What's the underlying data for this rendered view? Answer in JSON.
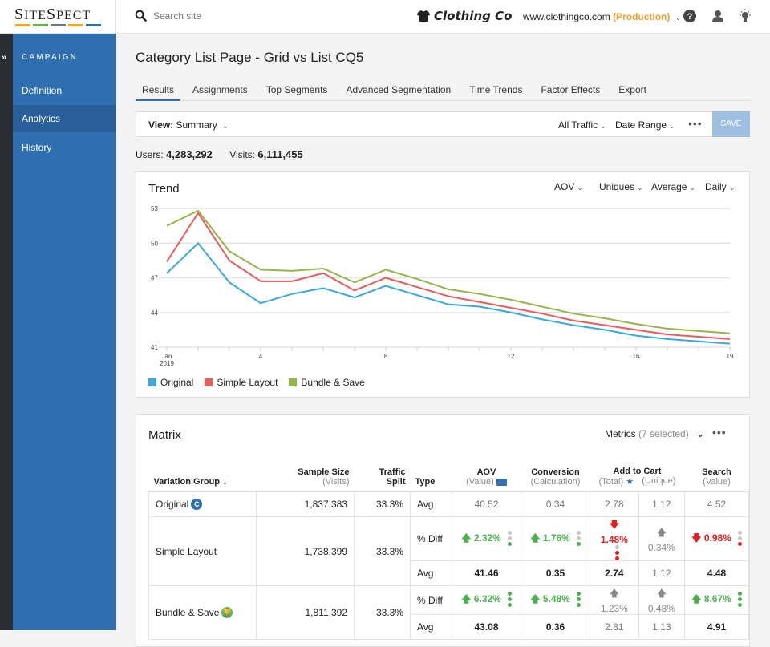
{
  "header": {
    "logo": "SiteSpect",
    "logo_colors": [
      "#f5a623",
      "#6ab04c",
      "#6c7a89",
      "#f5a623",
      "#2f6fb0"
    ],
    "search_placeholder": "Search site",
    "brand": "Clothing Co",
    "site_url": "www.clothingco.com",
    "site_env": "(Production)",
    "icons": [
      "help-icon",
      "user-icon",
      "lightbulb-icon"
    ]
  },
  "sidebar": {
    "collapse_label": "»",
    "section": "CAMPAIGN",
    "items": [
      {
        "label": "Definition",
        "active": false
      },
      {
        "label": "Analytics",
        "active": true
      },
      {
        "label": "History",
        "active": false
      }
    ]
  },
  "page": {
    "title": "Category List Page - Grid vs List CQ5",
    "tabs": [
      "Results",
      "Assignments",
      "Top Segments",
      "Advanced Segmentation",
      "Time Trends",
      "Factor Effects",
      "Export"
    ],
    "active_tab": "Results"
  },
  "viewbar": {
    "view_label": "View:",
    "view_value": "Summary",
    "traffic": "All Traffic",
    "date_range": "Date Range",
    "more": "•••",
    "save": "SAVE"
  },
  "stats": {
    "users_label": "Users:",
    "users": "4,283,292",
    "visits_label": "Visits:",
    "visits": "6,111,455"
  },
  "trend": {
    "title": "Trend",
    "controls": [
      "AOV",
      "Uniques",
      "Average",
      "Daily"
    ]
  },
  "chart_data": {
    "type": "line",
    "title": "Trend",
    "xlabel": "",
    "ylabel": "",
    "x": [
      1,
      2,
      3,
      4,
      5,
      6,
      7,
      8,
      9,
      10,
      11,
      12,
      13,
      14,
      15,
      16,
      17,
      18,
      19
    ],
    "x_tick_labels": [
      {
        "x": 1,
        "label": "Jan",
        "sublabel": "2019"
      },
      {
        "x": 4,
        "label": "4"
      },
      {
        "x": 8,
        "label": "8"
      },
      {
        "x": 12,
        "label": "12"
      },
      {
        "x": 16,
        "label": "16"
      },
      {
        "x": 19,
        "label": "19"
      }
    ],
    "yticks": [
      41,
      44,
      47,
      50,
      53
    ],
    "ylim": [
      41,
      53
    ],
    "xlim": [
      1,
      19
    ],
    "grid": true,
    "legend_position": "bottom-left",
    "series": [
      {
        "name": "Original",
        "color": "#3aa8dc",
        "values": [
          47.4,
          50.0,
          46.6,
          44.8,
          45.6,
          46.1,
          45.3,
          46.3,
          45.5,
          44.7,
          44.5,
          44.0,
          43.4,
          42.9,
          42.5,
          42.0,
          41.7,
          41.5,
          41.3
        ]
      },
      {
        "name": "Simple Layout",
        "color": "#ea5b5b",
        "values": [
          48.4,
          52.6,
          48.5,
          46.7,
          46.7,
          47.4,
          45.9,
          47.0,
          46.2,
          45.4,
          44.9,
          44.4,
          43.9,
          43.3,
          42.9,
          42.5,
          42.1,
          41.9,
          41.7
        ]
      },
      {
        "name": "Bundle & Save",
        "color": "#93b54a",
        "values": [
          51.5,
          52.8,
          49.3,
          47.7,
          47.6,
          47.8,
          46.6,
          47.7,
          46.9,
          46.0,
          45.6,
          45.1,
          44.5,
          43.9,
          43.5,
          43.0,
          42.6,
          42.4,
          42.2
        ]
      }
    ]
  },
  "matrix": {
    "title": "Matrix",
    "metrics_label": "Metrics",
    "metrics_count": "(7 selected)",
    "more": "•••",
    "headers": {
      "variation": "Variation Group",
      "sample": "Sample Size",
      "sample_sub": "(Visits)",
      "traffic": "Traffic",
      "traffic_sub": "Split",
      "type": "Type",
      "aov": "AOV",
      "aov_sub": "(Value)",
      "conversion": "Conversion",
      "conversion_sub": "(Calculation)",
      "cart": "Add to Cart",
      "cart_total": "(Total)",
      "cart_unique": "(Unique)",
      "search": "Search",
      "search_sub": "(Value)"
    },
    "rows": [
      {
        "name": "Original",
        "badge": "C",
        "badge_color": "#2f6fb0",
        "sample": "1,837,383",
        "split": "33.3%",
        "avg": [
          "40.52",
          "0.34",
          "2.78",
          "1.12",
          "4.52"
        ]
      },
      {
        "name": "Simple Layout",
        "sample": "1,738,399",
        "split": "33.3%",
        "diff": [
          {
            "value": "2.32%",
            "dir": "up",
            "sig": "green",
            "dots": [
              "gray",
              "gray",
              "green"
            ]
          },
          {
            "value": "1.76%",
            "dir": "up",
            "sig": "green",
            "dots": [
              "gray",
              "gray",
              "green"
            ]
          },
          {
            "value": "1.48%",
            "dir": "down",
            "sig": "red",
            "dots": [
              "gray",
              "red",
              "red"
            ]
          },
          {
            "value": "0.34%",
            "dir": "up",
            "sig": "gray",
            "dots": []
          },
          {
            "value": "0.98%",
            "dir": "down",
            "sig": "red",
            "dots": [
              "gray",
              "gray",
              "red"
            ]
          }
        ],
        "avg": [
          "41.46",
          "0.35",
          "2.74",
          "1.12",
          "4.48"
        ],
        "avg_bold": [
          true,
          true,
          true,
          false,
          true
        ]
      },
      {
        "name": "Bundle & Save",
        "badge": "trophy",
        "badge_color": "#5cb85c",
        "sample": "1,811,392",
        "split": "33.3%",
        "diff": [
          {
            "value": "6.32%",
            "dir": "up",
            "sig": "green",
            "dots": [
              "green",
              "green",
              "green"
            ]
          },
          {
            "value": "5.48%",
            "dir": "up",
            "sig": "green",
            "dots": [
              "green",
              "green",
              "green"
            ]
          },
          {
            "value": "1.23%",
            "dir": "up",
            "sig": "gray",
            "dots": []
          },
          {
            "value": "0.48%",
            "dir": "up",
            "sig": "gray",
            "dots": []
          },
          {
            "value": "8.67%",
            "dir": "up",
            "sig": "green",
            "dots": [
              "green",
              "green",
              "green"
            ]
          }
        ],
        "avg": [
          "43.08",
          "0.36",
          "2.81",
          "1.13",
          "4.91"
        ],
        "avg_bold": [
          true,
          true,
          false,
          false,
          true
        ]
      }
    ],
    "type_labels": {
      "avg": "Avg",
      "diff": "% Diff"
    }
  }
}
